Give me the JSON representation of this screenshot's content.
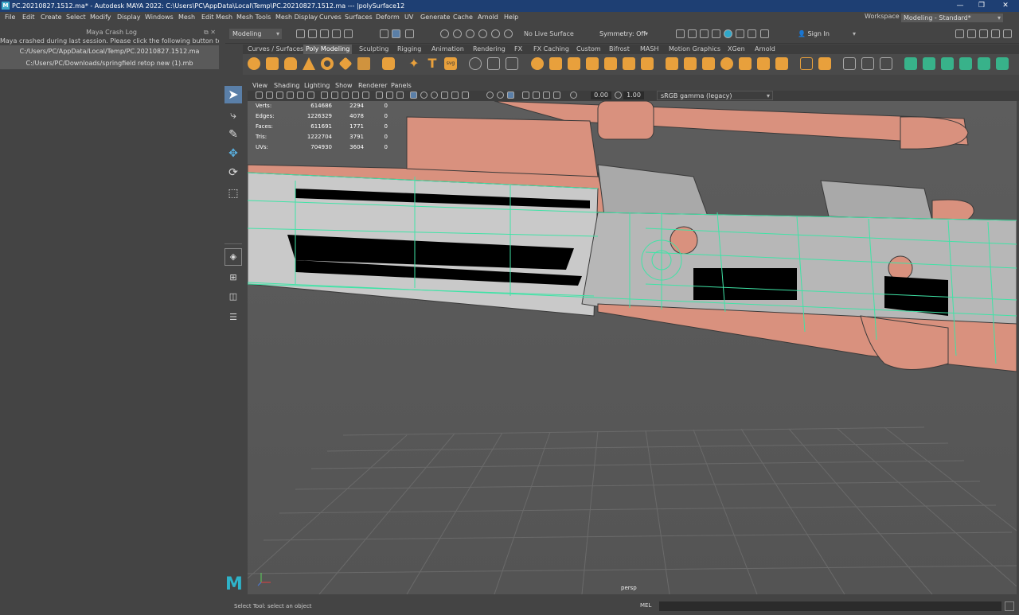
{
  "window": {
    "title": "PC.20210827.1512.ma* - Autodesk MAYA 2022: C:\\Users\\PC\\AppData\\Local\\Temp\\PC.20210827.1512.ma --- |polySurface12",
    "app_logo": "M"
  },
  "menubar": [
    "File",
    "Edit",
    "Create",
    "Select",
    "Modify",
    "Display",
    "Windows",
    "Mesh",
    "Edit Mesh",
    "Mesh Tools",
    "Mesh Display",
    "Curves",
    "Surfaces",
    "Deform",
    "UV",
    "Generate",
    "Cache",
    "Arnold",
    "Help"
  ],
  "workspace": {
    "label": "Workspace :",
    "value": "Modeling - Standard*"
  },
  "statusline": {
    "mode": "Modeling",
    "live_surface": "No Live Surface",
    "symmetry": "Symmetry: Off",
    "sign_in": "Sign In"
  },
  "shelf_tabs": [
    {
      "label": "Curves / Surfaces",
      "active": false
    },
    {
      "label": "Poly Modeling",
      "active": true
    },
    {
      "label": "Sculpting",
      "active": false
    },
    {
      "label": "Rigging",
      "active": false
    },
    {
      "label": "Animation",
      "active": false
    },
    {
      "label": "Rendering",
      "active": false
    },
    {
      "label": "FX",
      "active": false
    },
    {
      "label": "FX Caching",
      "active": false
    },
    {
      "label": "Custom",
      "active": false
    },
    {
      "label": "Bifrost",
      "active": false
    },
    {
      "label": "MASH",
      "active": false
    },
    {
      "label": "Motion Graphics",
      "active": false
    },
    {
      "label": "XGen",
      "active": false
    },
    {
      "label": "Arnold",
      "active": false
    }
  ],
  "crash_log": {
    "title": "Maya Crash Log",
    "message": "Maya crashed during last session. Please click the following button to retrieve si",
    "files": [
      "C:/Users/PC/AppData/Local/Temp/PC.20210827.1512.ma",
      "C:/Users/PC/Downloads/springfield retop new (1).mb"
    ]
  },
  "viewport_menu": [
    "View",
    "Shading",
    "Lighting",
    "Show",
    "Renderer",
    "Panels"
  ],
  "viewport_toolbar": {
    "exposure": "0.00",
    "gamma": "1.00",
    "color_space": "sRGB gamma (legacy)"
  },
  "hud": [
    {
      "label": "Verts:",
      "total": "614686",
      "selected": "2294",
      "components": "0"
    },
    {
      "label": "Edges:",
      "total": "1226329",
      "selected": "4078",
      "components": "0"
    },
    {
      "label": "Faces:",
      "total": "611691",
      "selected": "1771",
      "components": "0"
    },
    {
      "label": "Tris:",
      "total": "1222704",
      "selected": "3791",
      "components": "0"
    },
    {
      "label": "UVs:",
      "total": "704930",
      "selected": "3604",
      "components": "0"
    }
  ],
  "camera_label": "persp",
  "command_line": {
    "language": "MEL",
    "help_text": "Select Tool: select an object"
  },
  "colors": {
    "title_bg": "#1e3f73",
    "model": "#d9917e",
    "wireframe": "#3fe3a6",
    "viewport_bg": "#5b5b5b"
  }
}
